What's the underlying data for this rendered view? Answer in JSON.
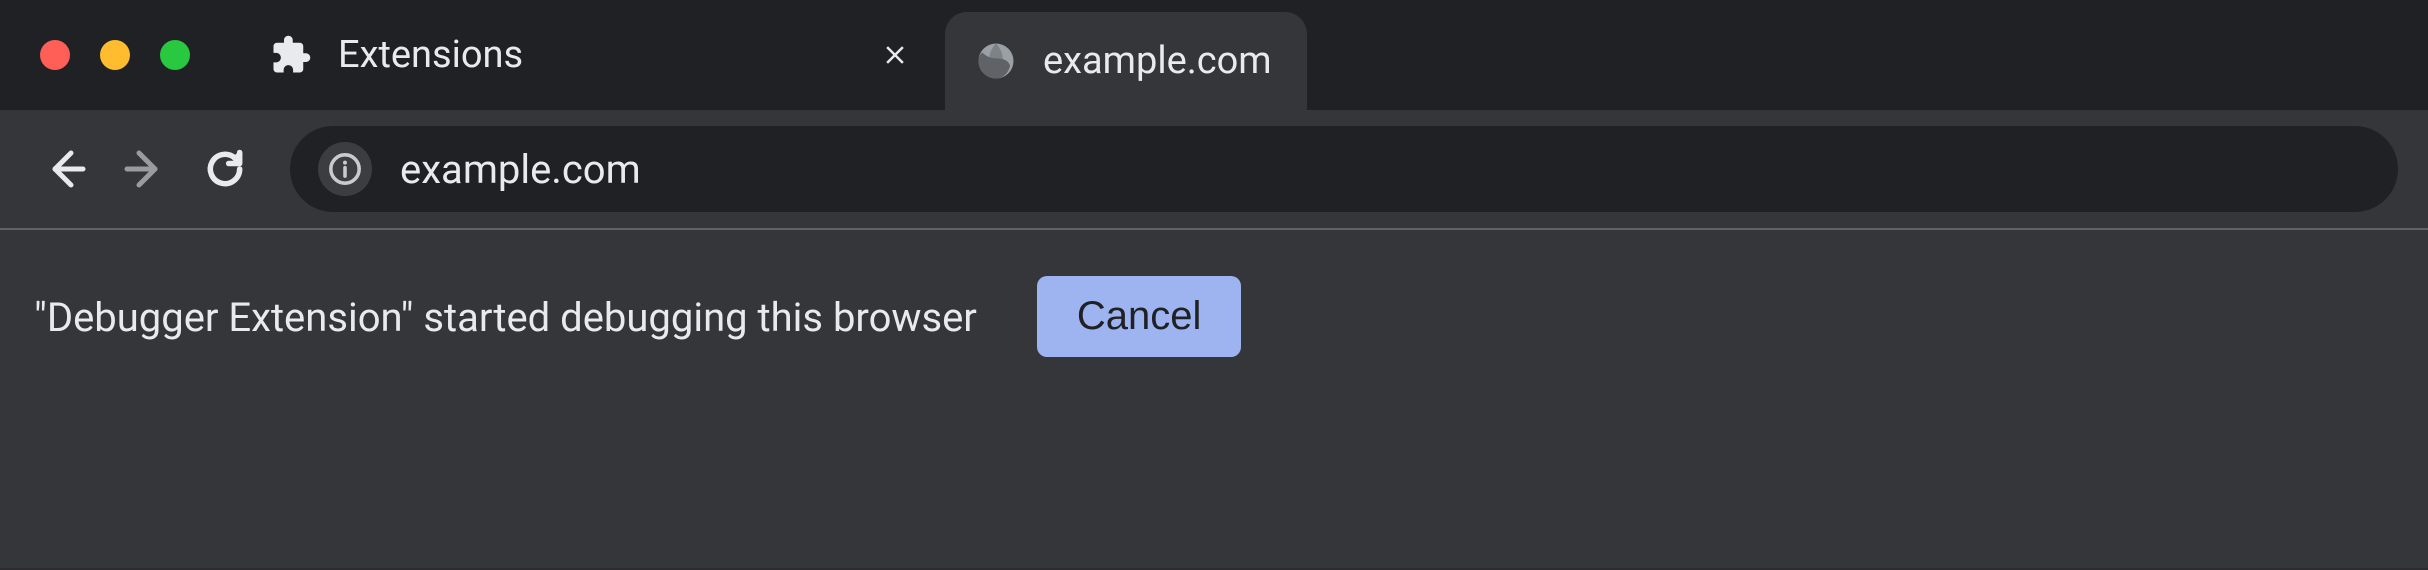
{
  "traffic_lights": {
    "close": "#ff5f57",
    "min": "#febc2e",
    "zoom": "#28c840"
  },
  "tabs": [
    {
      "title": "Extensions",
      "icon": "extension-icon",
      "active": false,
      "closeable": true
    },
    {
      "title": "example.com",
      "icon": "globe-icon",
      "active": true,
      "closeable": false
    }
  ],
  "toolbar": {
    "back_enabled": true,
    "forward_enabled": false,
    "reload_label": "Reload"
  },
  "omnibox": {
    "site_info_icon": "info-icon",
    "url": "example.com"
  },
  "infobar": {
    "message": "\"Debugger Extension\" started debugging this browser",
    "cancel_label": "Cancel"
  }
}
